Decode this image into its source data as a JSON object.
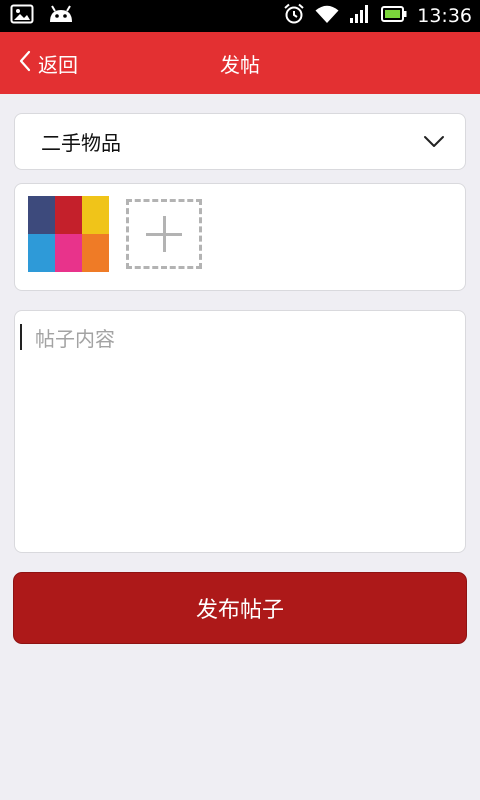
{
  "status_bar": {
    "time": "13:36",
    "icons": [
      "gallery-notification-icon",
      "android-notification-icon",
      "alarm-icon",
      "wifi-icon",
      "signal-icon",
      "battery-icon"
    ]
  },
  "header": {
    "back_label": "返回",
    "title": "发帖",
    "background": "#e33032"
  },
  "form": {
    "category": {
      "selected": "二手物品"
    },
    "photos": {
      "thumbnail_colors": [
        "#3d4a7c",
        "#c4202b",
        "#f0c419",
        "#2e9ad8",
        "#e8338b",
        "#ef7b26"
      ]
    },
    "content": {
      "placeholder": "帖子内容",
      "value": ""
    },
    "submit_label": "发布帖子",
    "submit_color": "#ad1919"
  }
}
